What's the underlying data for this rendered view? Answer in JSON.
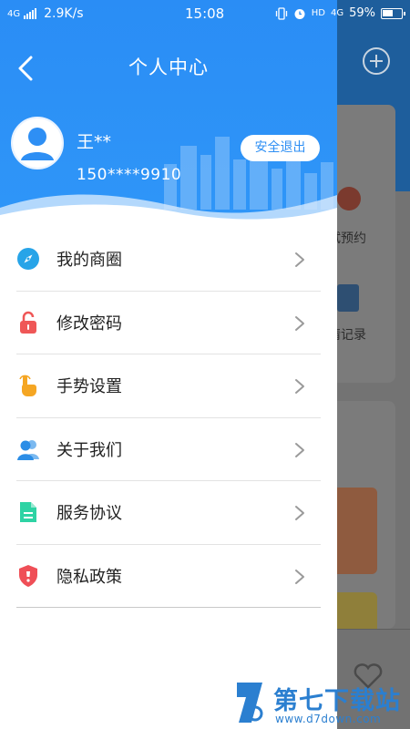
{
  "status_bar": {
    "network": "4G",
    "speed": "2.9K/s",
    "time": "15:08",
    "hd": "HD",
    "network2": "4G",
    "battery": "59%",
    "battery_level": 0.59
  },
  "header": {
    "title": "个人中心"
  },
  "user": {
    "name": "王**",
    "phone": "150****9910",
    "logout_label": "安全退出"
  },
  "menu": {
    "items": [
      {
        "label": "我的商圈",
        "icon": "compass-icon",
        "color": "#27a4e8"
      },
      {
        "label": "修改密码",
        "icon": "lock-icon",
        "color": "#ef5757"
      },
      {
        "label": "手势设置",
        "icon": "hand-pointer-icon",
        "color": "#f5a623"
      },
      {
        "label": "关于我们",
        "icon": "users-icon",
        "color": "#2b8de6"
      },
      {
        "label": "服务协议",
        "icon": "document-icon",
        "color": "#2ed3a4"
      },
      {
        "label": "隐私政策",
        "icon": "shield-icon",
        "color": "#ef4f57"
      }
    ]
  },
  "background": {
    "text_appointment": "试预约",
    "text_record": "请记录"
  },
  "watermark": {
    "cn": "第七下载站",
    "en": "www.d7down.com"
  },
  "colors": {
    "primary": "#2e8ff4",
    "overlay": "#737373"
  }
}
